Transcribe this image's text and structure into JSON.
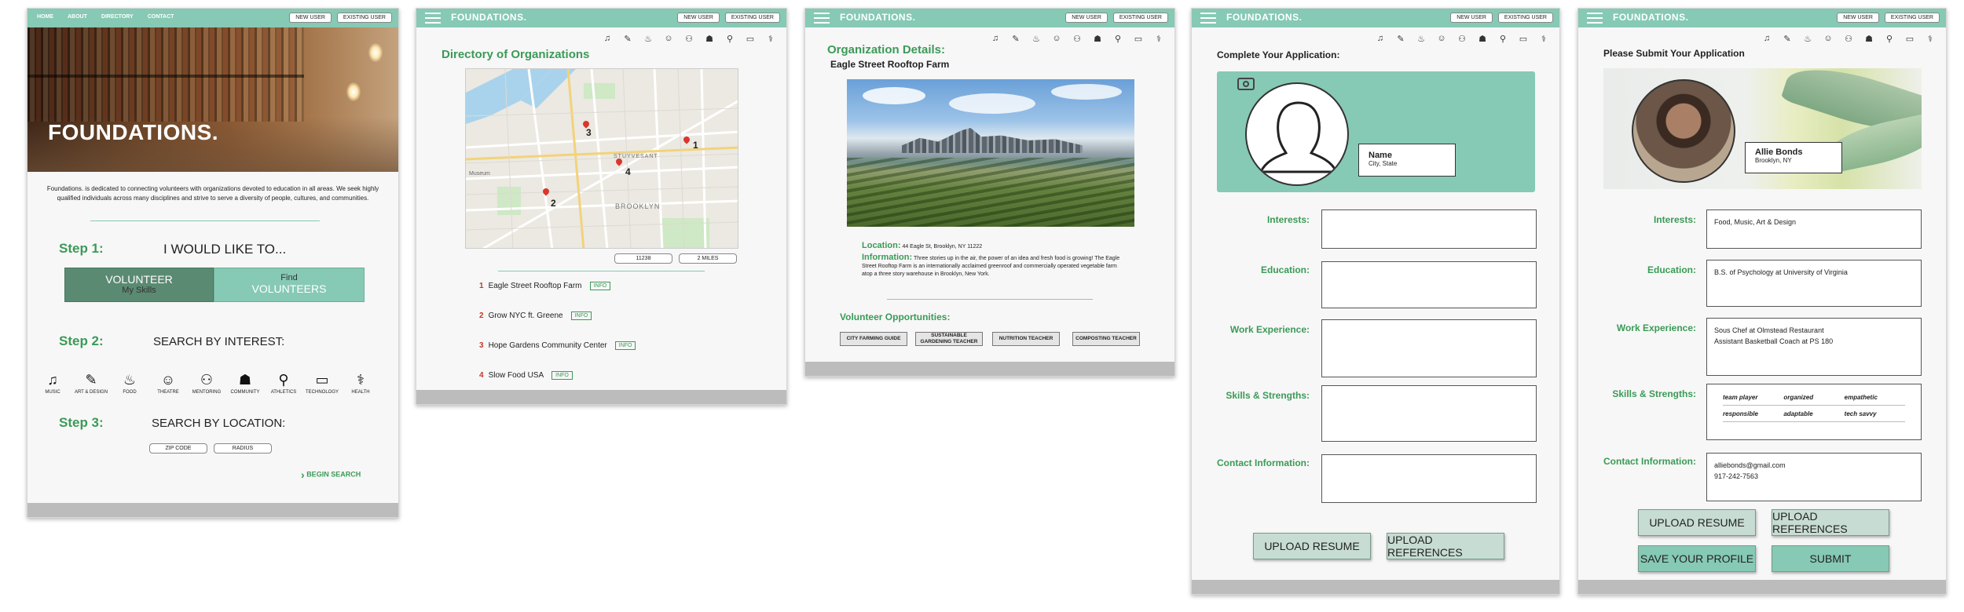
{
  "common": {
    "new_user": "NEW USER",
    "existing_user": "EXISTING USER",
    "brand": "FOUNDATIONS."
  },
  "home": {
    "nav": [
      "HOME",
      "ABOUT",
      "DIRECTORY",
      "CONTACT"
    ],
    "hero_title": "FOUNDATIONS.",
    "intro": "Foundations. is dedicated to connecting volunteers with organizations devoted to education in all areas. We seek highly qualified individuals across many disciplines and strive to serve a diversity of people, cultures, and communities.",
    "step1_label": "Step 1:",
    "step1_text": "I WOULD LIKE TO...",
    "volunteer_title": "VOLUNTEER",
    "volunteer_sub": "My Skills",
    "find_title": "Find",
    "find_sub": "VOLUNTEERS",
    "step2_label": "Step 2:",
    "step2_text": "SEARCH BY INTEREST:",
    "categories": [
      {
        "label": "MUSIC",
        "icon": "♫"
      },
      {
        "label": "ART & DESIGN",
        "icon": "✎"
      },
      {
        "label": "FOOD",
        "icon": "♨"
      },
      {
        "label": "THEATRE",
        "icon": "☺"
      },
      {
        "label": "MENTORING",
        "icon": "⚇"
      },
      {
        "label": "COMMUNITY",
        "icon": "☗"
      },
      {
        "label": "ATHLETICS",
        "icon": "⚲"
      },
      {
        "label": "TECHNOLOGY",
        "icon": "▭"
      },
      {
        "label": "HEALTH",
        "icon": "⚕"
      }
    ],
    "step3_label": "Step 3:",
    "step3_text": "SEARCH BY LOCATION:",
    "zip_label": "ZIP CODE",
    "radius_label": "RADIUS",
    "begin_search": "BEGIN SEARCH"
  },
  "directory": {
    "title": "Directory of Organizations",
    "zip_value": "11238",
    "radius_value": "2 MILES",
    "map_label_brooklyn": "BROOKLYN",
    "map_label_stuyvesant": "STUYVESANT",
    "map_label_museum": "Museum",
    "map_markers": [
      "1",
      "2",
      "3",
      "4"
    ],
    "info_label": "INFO",
    "orgs": [
      {
        "num": "1",
        "name": "Eagle Street Rooftop Farm"
      },
      {
        "num": "2",
        "name": "Grow NYC ft. Greene"
      },
      {
        "num": "3",
        "name": "Hope Gardens Community Center"
      },
      {
        "num": "4",
        "name": "Slow Food USA"
      }
    ]
  },
  "details": {
    "title": "Organization Details:",
    "org_name": "Eagle Street Rooftop Farm",
    "location_label": "Location:",
    "location_value": "44 Eagle St, Brooklyn, NY 11222",
    "info_label": "Information:",
    "info_value": "Three stories up in the air, the power of an idea and fresh food is growing! The Eagle Street Rooftop Farm is an internationally acclaimed greenroof and commercially operated vegetable farm atop a three story warehouse in Brooklyn, New York.",
    "opps_title": "Volunteer Opportunities:",
    "opps": [
      "CITY FARMING GUIDE",
      "SUSTAINABLE GARDENING TEACHER",
      "NUTRITION TEACHER",
      "COMPOSTING TEACHER"
    ]
  },
  "apply": {
    "title": "Complete Your Application:",
    "name": "Name",
    "city": "City, State",
    "labels": [
      "Interests:",
      "Education:",
      "Work Experience:",
      "Skills & Strengths:",
      "Contact Information:"
    ],
    "upload_resume": "UPLOAD RESUME",
    "upload_refs": "UPLOAD REFERENCES"
  },
  "submit": {
    "title": "Please Submit Your Application",
    "name": "Allie Bonds",
    "city": "Brooklyn, NY",
    "labels": [
      "Interests:",
      "Education:",
      "Work Experience:",
      "Skills & Strengths:",
      "Contact Information:"
    ],
    "interests": "Food, Music, Art & Design",
    "education": "B.S. of Psychology at University of Virginia",
    "work1": "Sous Chef at Olmstead Restaurant",
    "work2": "Assistant Basketball Coach at PS 180",
    "skills": [
      "team player",
      "organized",
      "empathetic",
      "responsible",
      "adaptable",
      "tech savvy"
    ],
    "email": "alliebonds@gmail.com",
    "phone": "917-242-7563",
    "upload_resume": "UPLOAD RESUME",
    "upload_refs": "UPLOAD REFERENCES",
    "save_profile": "SAVE YOUR PROFILE",
    "submit_btn": "SUBMIT"
  }
}
